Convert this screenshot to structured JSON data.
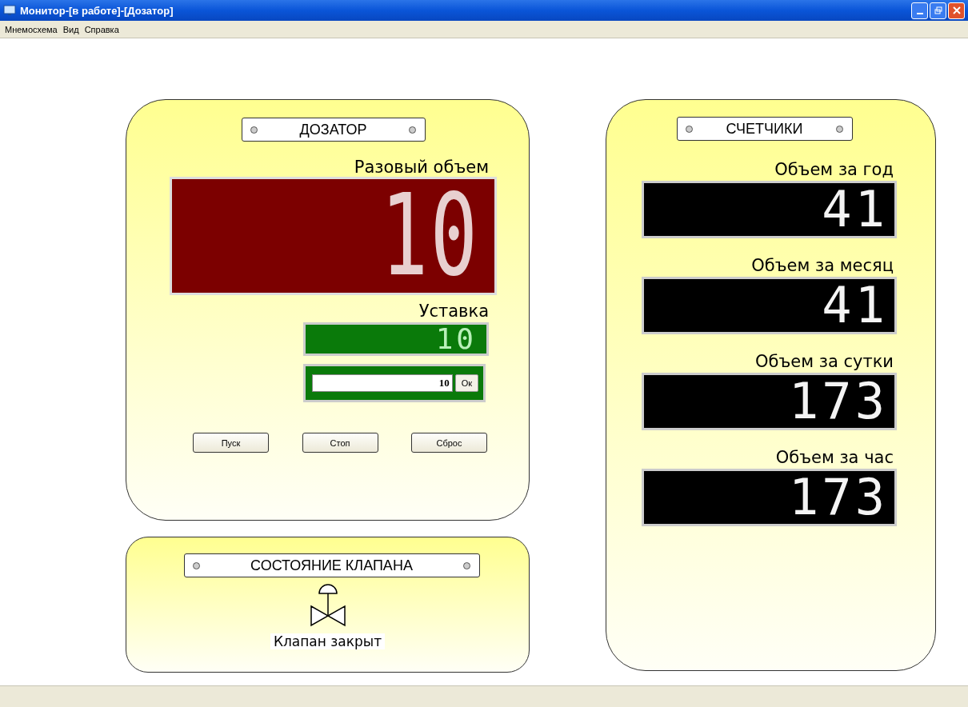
{
  "window": {
    "title": "Монитор-[в работе]-[Дозатор]"
  },
  "menu": [
    "Мнемосхема",
    "Вид",
    "Справка"
  ],
  "dosator": {
    "title": "ДОЗАТОР",
    "volume_label": "Разовый объем",
    "volume_value": "10",
    "setpoint_label": "Уставка",
    "setpoint_value": "10",
    "input_value": "10",
    "ok_button": "Ок",
    "buttons": [
      "Пуск",
      "Стоп",
      "Сброс"
    ]
  },
  "valve": {
    "title": "СОСТОЯНИЕ КЛАПАНА",
    "status": "Клапан закрыт",
    "open": false
  },
  "counters": {
    "title": "СЧЕТЧИКИ",
    "items": [
      {
        "label": "Объем за год",
        "value": "41"
      },
      {
        "label": "Объем за месяц",
        "value": "41"
      },
      {
        "label": "Объем за сутки",
        "value": "173"
      },
      {
        "label": "Объем за час",
        "value": "173"
      }
    ]
  }
}
